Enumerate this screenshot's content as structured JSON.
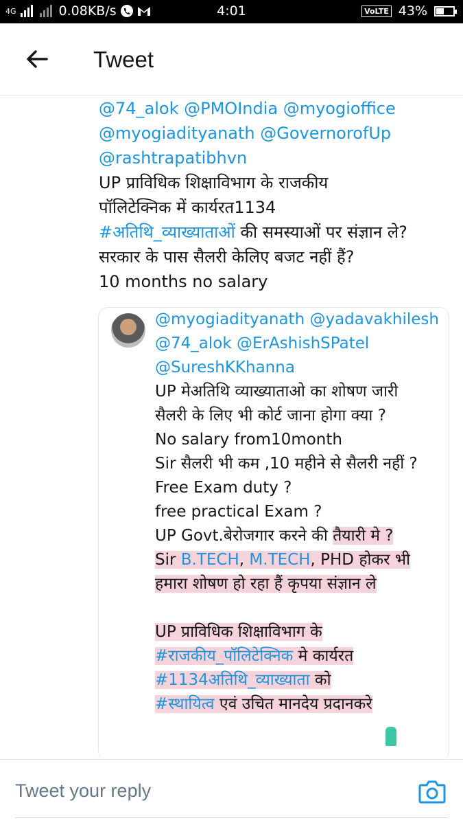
{
  "status_bar": {
    "network": "4G",
    "speed": "0.08KB/s",
    "time": "4:01",
    "volte": "VoLTE",
    "battery": "43%",
    "battery_level": 0.43
  },
  "header": {
    "title": "Tweet",
    "back_icon": "arrow-left-icon"
  },
  "tweet": {
    "mentions_line1": "@74_alok @PMOIndia @myogioffice",
    "mentions_line2": "@myogiadityanath @GovernorofUp",
    "mentions_line3": "@rashtrapatibhvn",
    "text_line1": "UP प्राविधिक शिक्षाविभाग के राजकीय",
    "text_line2": "पॉलिटेक्निक में कार्यरत1134",
    "hashtag": "#अतिथि_व्याख्याताओं",
    "text_line3_rest": " की समस्याओं पर संज्ञान ले?",
    "text_line4": "सरकार के पास सैलरी केलिए बजट नहीं हैं?",
    "text_line5": "10 months no salary"
  },
  "quoted_tweet": {
    "mention_line1": "@myogiadityanath @yadavakhilesh",
    "mention_line2": "@74_alok @ErAshishSPatel",
    "mention_line3": "@SureshKKhanna",
    "line1": "UP मेअतिथि व्याख्याताओ का शोषण जारी",
    "line2": "सैलरी के लिए भी कोर्ट जाना होगा क्या ?",
    "line3": "No salary from10month",
    "line4": "Sir सैलरी भी कम ,10 महीने से सैलरी नहीं ?",
    "line5": "Free Exam duty ?",
    "line6": "free practical Exam ?",
    "line7a": "UP Govt.बेरोजगार करने की ",
    "line7b": "तैयारी मे ?",
    "line8_sir": "Sir ",
    "line8_btech": "B.TECH",
    "line8_comma1": ", ",
    "line8_mtech": "M.TECH",
    "line8_rest": ", PHD  होकर भी",
    "line9": "हमारा शोषण हो रहा हैं कृपया संज्ञान ले",
    "line10": "UP प्राविधिक शिक्षाविभाग के",
    "line11_tag": "#राजकीय_पॉलिटेक्निक",
    "line11_rest": " मे कार्यरत",
    "line12_tag": "#1134अतिथि_व्याख्याता",
    "line12_rest": " को",
    "line13_tag": "#स्थायित्व",
    "line13_rest": " एवं उचित मानदेय प्रदानकरे"
  },
  "reply": {
    "placeholder": "Tweet your reply",
    "camera_icon": "camera-icon"
  },
  "colors": {
    "link": "#1b95e0",
    "highlight": "#f6d3da"
  }
}
